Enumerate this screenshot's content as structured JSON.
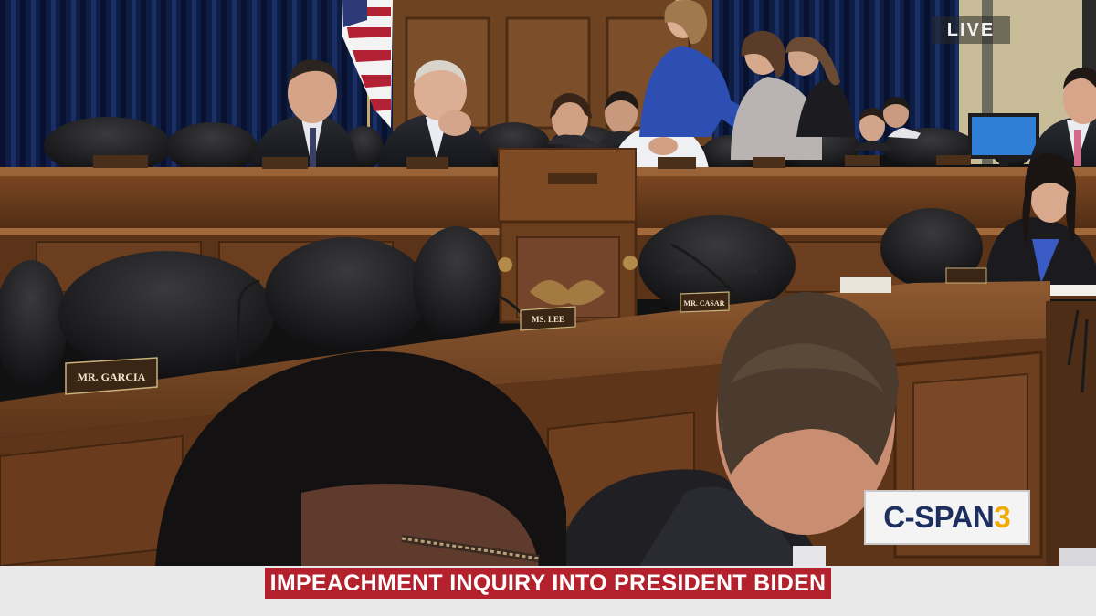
{
  "broadcast": {
    "live_label": "LIVE",
    "network": "C-SPAN",
    "channel_number": "3",
    "headline": "IMPEACHMENT INQUIRY INTO PRESIDENT BIDEN",
    "headline_color": "#b3212c"
  },
  "nameplates": {
    "front_left": "MR. GARCIA",
    "front_center_left": "MS. LEE",
    "front_center": "MR. CASAR"
  },
  "colors": {
    "curtain": "#0c1a3a",
    "wood_dark": "#5a3418",
    "wood_light": "#8a5530",
    "chair_leather": "#1c1c1e",
    "logo_navy": "#1d2f5f",
    "logo_gold": "#f2a900"
  }
}
